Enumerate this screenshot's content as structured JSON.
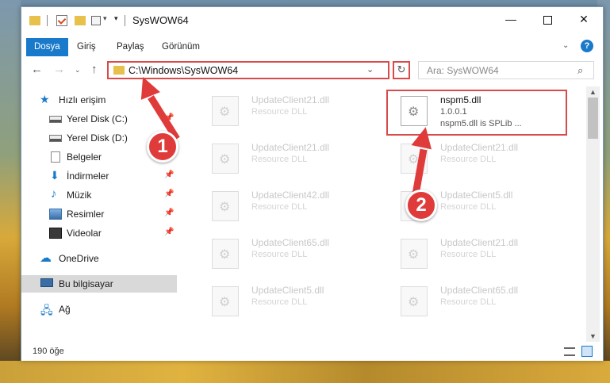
{
  "window": {
    "title": "SysWOW64",
    "min_glyph": "—",
    "close_glyph": "✕"
  },
  "ribbon": {
    "tabs": [
      "Dosya",
      "Giriş",
      "Paylaş",
      "Görünüm"
    ],
    "help": "?"
  },
  "nav": {
    "address": "C:\\Windows\\SysWOW64",
    "search_placeholder": "Ara: SysWOW64"
  },
  "sidebar": {
    "items": [
      {
        "label": "Hızlı erişim",
        "icon": "star-icon",
        "pinned": false
      },
      {
        "label": "Yerel Disk (C:)",
        "icon": "drive-icon",
        "pinned": true
      },
      {
        "label": "Yerel Disk (D:)",
        "icon": "drive-icon",
        "pinned": false
      },
      {
        "label": "Belgeler",
        "icon": "documents-icon",
        "pinned": true
      },
      {
        "label": "İndirmeler",
        "icon": "downloads-icon",
        "pinned": true
      },
      {
        "label": "Müzik",
        "icon": "music-icon",
        "pinned": true
      },
      {
        "label": "Resimler",
        "icon": "pictures-icon",
        "pinned": true
      },
      {
        "label": "Videolar",
        "icon": "videos-icon",
        "pinned": true
      },
      {
        "label": "OneDrive",
        "icon": "cloud-icon",
        "pinned": false
      },
      {
        "label": "Bu bilgisayar",
        "icon": "pc-icon",
        "pinned": false,
        "selected": true
      },
      {
        "label": "Ağ",
        "icon": "network-icon",
        "pinned": false
      }
    ]
  },
  "files": [
    {
      "name": "UpdateClient21.dll",
      "desc": "Resource DLL"
    },
    {
      "name": "nspm5.dll",
      "desc": "1.0.0.1",
      "desc2": "nspm5.dll is SPLib ...",
      "highlighted": true
    },
    {
      "name": "UpdateClient21.dll",
      "desc": "Resource DLL"
    },
    {
      "name": "UpdateClient21.dll",
      "desc": "Resource DLL"
    },
    {
      "name": "UpdateClient42.dll",
      "desc": "Resource DLL"
    },
    {
      "name": "UpdateClient5.dll",
      "desc": "Resource DLL"
    },
    {
      "name": "UpdateClient65.dll",
      "desc": "Resource DLL"
    },
    {
      "name": "UpdateClient21.dll",
      "desc": "Resource DLL"
    },
    {
      "name": "UpdateClient5.dll",
      "desc": "Resource DLL"
    },
    {
      "name": "UpdateClient65.dll",
      "desc": "Resource DLL"
    }
  ],
  "status": {
    "count": "190 öğe"
  },
  "annotations": {
    "badge1": "1",
    "badge2": "2",
    "color": "#e03b3b"
  }
}
